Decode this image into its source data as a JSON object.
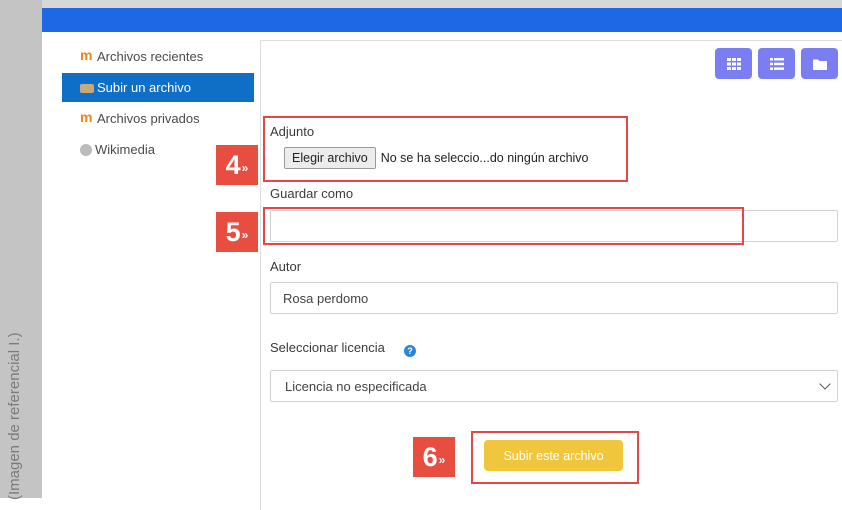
{
  "caption": "(Imagen de referencial I.)",
  "sidebar": {
    "items": [
      {
        "label": "Archivos recientes",
        "icon": "moodle-m-icon"
      },
      {
        "label": "Subir un archivo",
        "icon": "upload-icon",
        "active": true
      },
      {
        "label": "Archivos privados",
        "icon": "moodle-m-icon"
      },
      {
        "label": "Wikimedia",
        "icon": "wikimedia-icon"
      }
    ]
  },
  "toolbar": {
    "view_icons": [
      "grid-view-icon",
      "list-view-icon",
      "folder-view-icon"
    ]
  },
  "form": {
    "attachment_label": "Adjunto",
    "choose_file_label": "Elegir archivo",
    "no_file_text": "No se ha seleccio...do ningún archivo",
    "save_as_label": "Guardar como",
    "save_as_value": "",
    "author_label": "Autor",
    "author_value": "Rosa perdomo",
    "license_label": "Seleccionar licencia",
    "license_value": "Licencia no especificada",
    "submit_label": "Subir este archivo"
  },
  "steps": {
    "step4": "4",
    "step5": "5",
    "step6": "6",
    "marker": "»"
  },
  "colors": {
    "topbar": "#1e67e5",
    "active_nav": "#0f6fc6",
    "view_button": "#7b7ef0",
    "submit_button": "#f0c63c",
    "highlight": "#e14848",
    "step_badge": "#e84e40"
  }
}
